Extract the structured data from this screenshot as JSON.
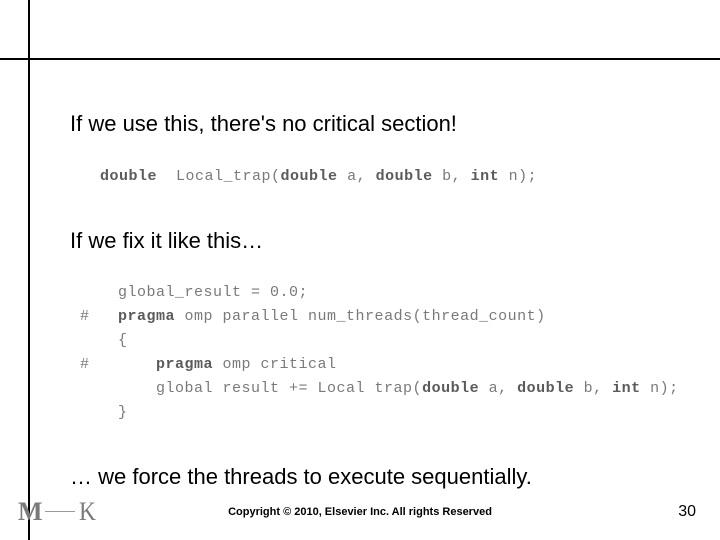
{
  "body": {
    "line1": "If we use this, there's no critical section!",
    "code1": {
      "text": "double  Local_trap(double a, double b, int n);"
    },
    "line2": "If we fix it like this…",
    "code2": {
      "l1": "    global_result = 0.0;",
      "l2": "#   pragma omp parallel num_threads(thread_count)",
      "l3": "    {",
      "l4": "#       pragma omp critical",
      "l5": "        global result += Local trap(double a, double b, int n);",
      "l6": "    }"
    },
    "line3": "… we force the threads to execute sequentially."
  },
  "footer": {
    "logo_letters": {
      "m": "M",
      "k": "K"
    },
    "copyright": "Copyright © 2010, Elsevier Inc. All rights Reserved",
    "page_number": "30"
  }
}
